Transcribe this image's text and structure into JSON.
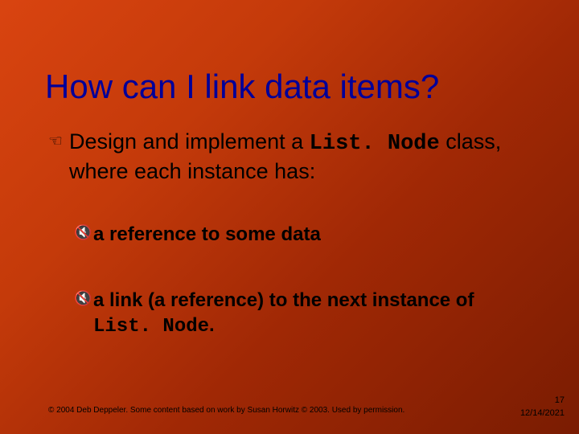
{
  "title": "How can I link data items?",
  "bullet1_pre": "Design and implement a ",
  "bullet1_code": "List. Node",
  "bullet1_post": " class, where each instance has:",
  "bullet2a": "a reference to some data",
  "bullet2b_pre": "a link (a reference) to the next instance of ",
  "bullet2b_code": "List. Node",
  "bullet2b_post": ".",
  "footer": "© 2004 Deb Deppeler.  Some content based on work by Susan Horwitz © 2003.  Used by permission.",
  "page": "17",
  "date": "12/14/2021"
}
